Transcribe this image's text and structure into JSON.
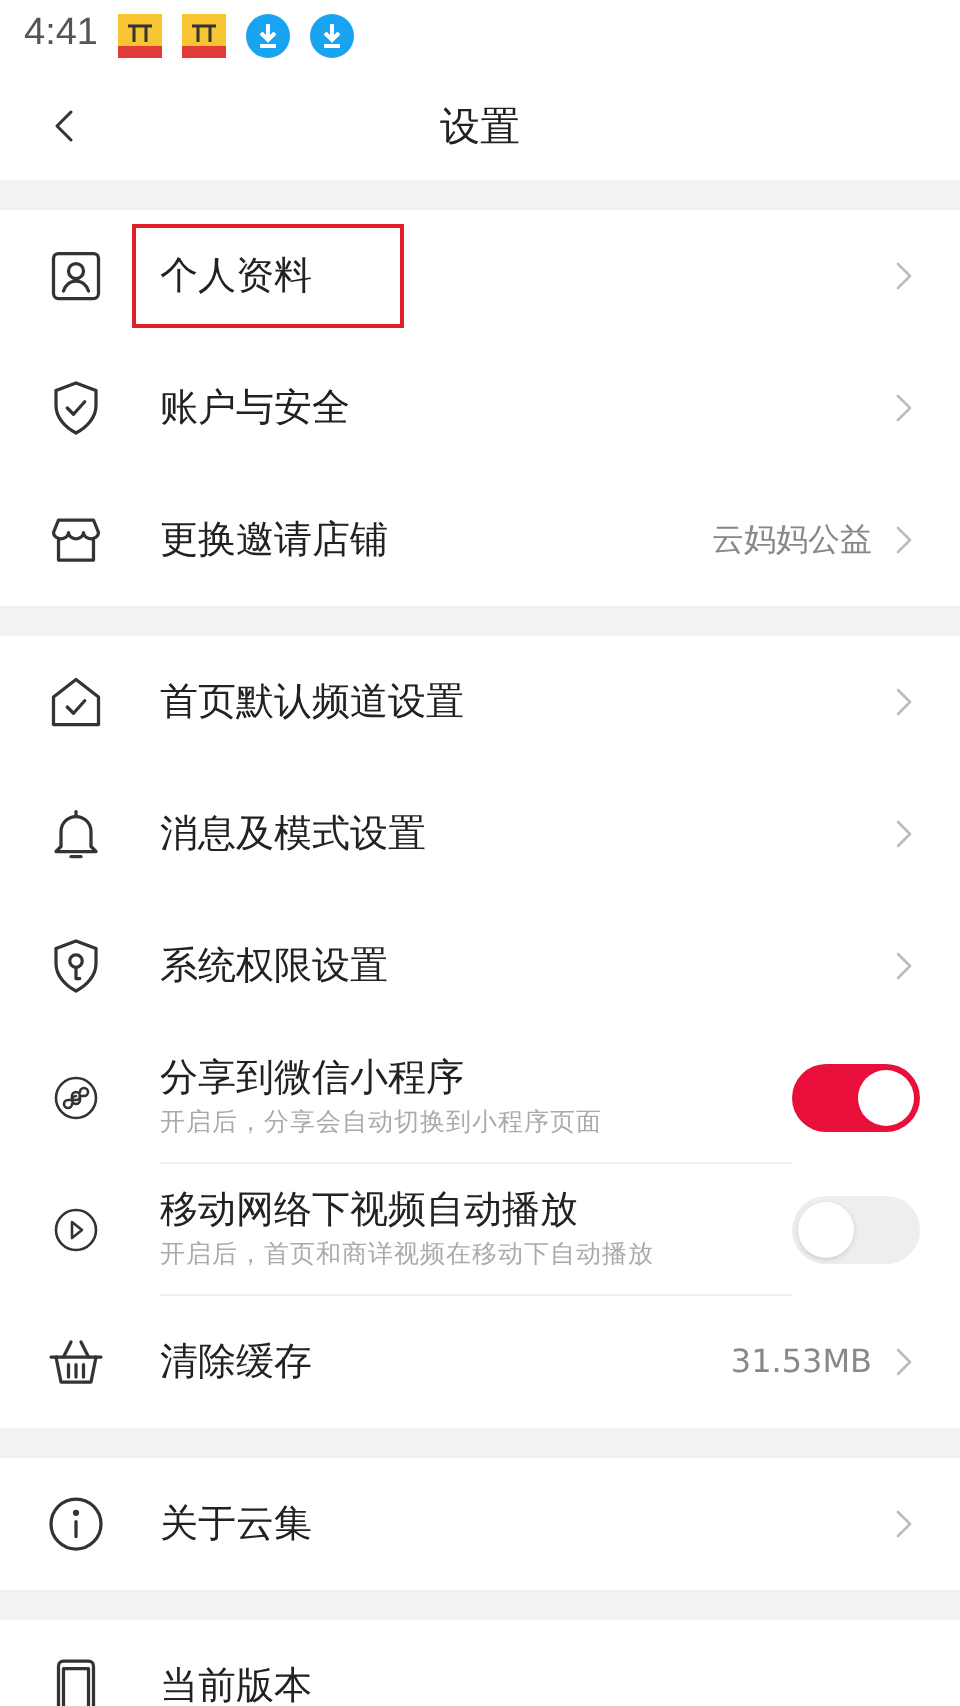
{
  "status_bar": {
    "time": "4:41"
  },
  "header": {
    "title": "设置"
  },
  "groups": [
    {
      "items": [
        {
          "kind": "link",
          "label": "个人资料",
          "highlighted": true
        },
        {
          "kind": "link",
          "label": "账户与安全",
          "highlighted": false
        },
        {
          "kind": "link",
          "label": "更换邀请店铺",
          "value": "云妈妈公益",
          "highlighted": false
        }
      ]
    },
    {
      "items": [
        {
          "kind": "link",
          "label": "首页默认频道设置",
          "highlighted": false
        },
        {
          "kind": "link",
          "label": "消息及模式设置",
          "highlighted": false
        },
        {
          "kind": "link",
          "label": "系统权限设置",
          "highlighted": false
        },
        {
          "kind": "toggle",
          "label": "分享到微信小程序",
          "hint": "开启后，分享会自动切换到小程序页面",
          "on": true
        },
        {
          "kind": "toggle",
          "label": "移动网络下视频自动播放",
          "hint": "开启后，首页和商详视频在移动下自动播放",
          "on": false
        },
        {
          "kind": "link",
          "label": "清除缓存",
          "value": "31.53MB",
          "highlighted": false
        }
      ]
    },
    {
      "items": [
        {
          "kind": "link",
          "label": "关于云集",
          "highlighted": false
        }
      ]
    },
    {
      "items": [
        {
          "kind": "cut",
          "label": "当前版本"
        }
      ]
    }
  ]
}
